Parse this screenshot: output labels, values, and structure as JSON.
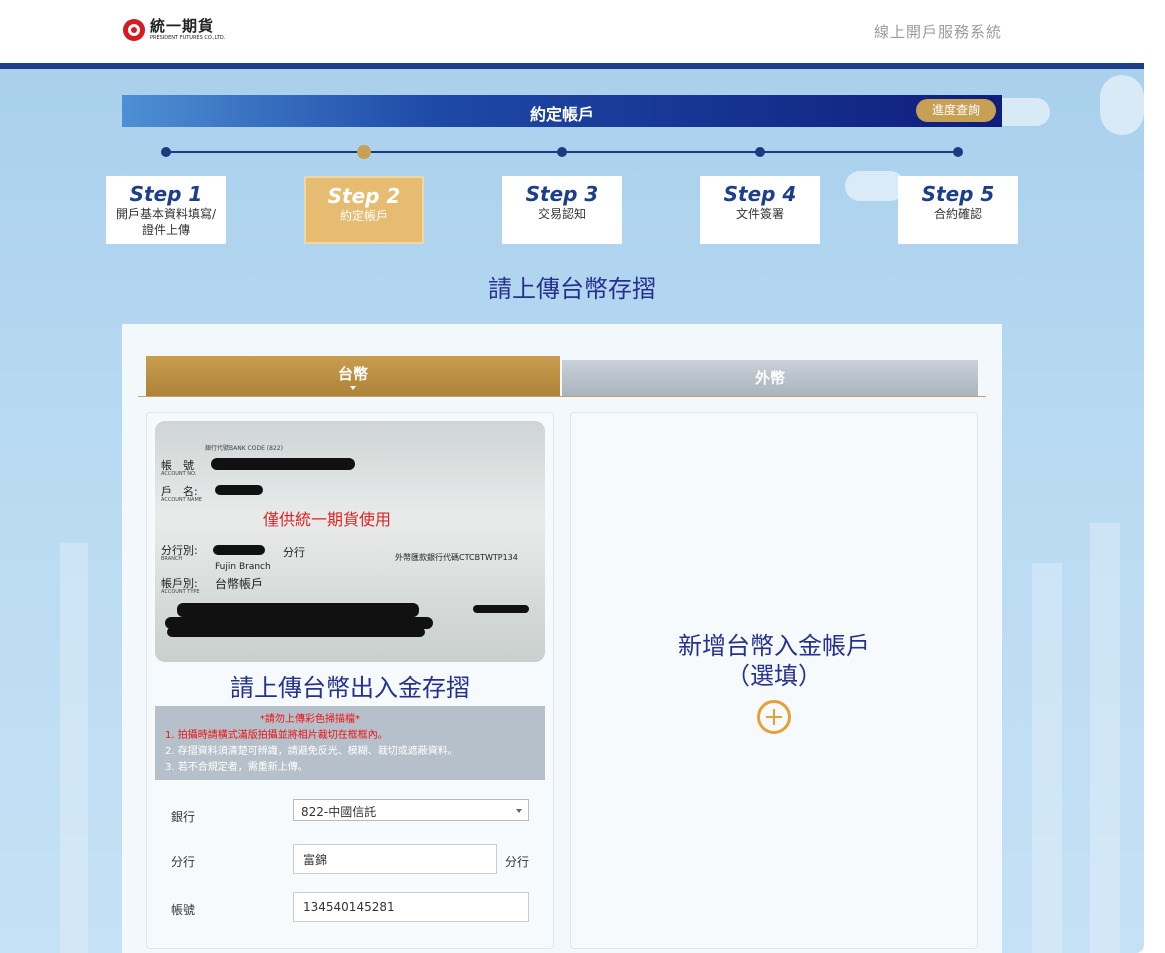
{
  "brand": {
    "name_cn": "統一期貨",
    "name_en": "PRESIDENT FUTURES CO.,LTD."
  },
  "system_title": "線上開戶服務系統",
  "header": {
    "title": "約定帳戶",
    "progress_button": "進度查詢"
  },
  "steps": [
    {
      "no": "Step 1",
      "label": "開戶基本資料填寫/證件上傳",
      "active": false
    },
    {
      "no": "Step 2",
      "label": "約定帳戶",
      "active": true
    },
    {
      "no": "Step 3",
      "label": "交易認知",
      "active": false
    },
    {
      "no": "Step 4",
      "label": "文件簽署",
      "active": false
    },
    {
      "no": "Step 5",
      "label": "合約確認",
      "active": false
    }
  ],
  "page_heading": "請上傳台幣存摺",
  "tabs": {
    "twd": "台幣",
    "fx": "外幣"
  },
  "passbook": {
    "bank_code_caption": "銀行代號BANK CODE (822)",
    "account_no_label": "帳　號",
    "account_no_en": "ACCOUNT NO.",
    "account_name_label": "戶　名:",
    "account_name_en": "ACCOUNT NAME",
    "watermark": "僅供統一期貨使用",
    "branch_label": "分行別:",
    "branch_en": "BRANCH",
    "branch_suffix": "分行",
    "branch_name_en": "Fujin Branch",
    "fx_code": "外幣匯款銀行代碼CTCBTWTP134",
    "account_type_label": "帳戶別:",
    "account_type_en": "ACCOUNT TYPE",
    "account_type_value": "台幣帳戶"
  },
  "upload_title": "請上傳台幣出入金存摺",
  "notes": {
    "warning": "*請勿上傳彩色掃描檔*",
    "item1": "1. 拍攝時請橫式滿版拍攝並將相片裁切在框框內。",
    "item2": "2. 存摺資料須清楚可辨識，請避免反光、模糊、裁切或遮蔽資料。",
    "item3": "3. 若不合規定者，需重新上傳。"
  },
  "form": {
    "bank_label": "銀行",
    "bank_value": "822-中國信託",
    "branch_label": "分行",
    "branch_value": "富錦",
    "branch_suffix": "分行",
    "account_label": "帳號",
    "account_value": "134540145281"
  },
  "add_account": {
    "line1": "新增台幣入金帳戶",
    "line2": "（選填）"
  },
  "colors": {
    "navy": "#24318f",
    "gold": "#c8a055",
    "step_active": "#e6bc72",
    "tab_gold": "#b88d3f",
    "tab_gray": "#b0bac4",
    "warning_red": "#e11111"
  }
}
